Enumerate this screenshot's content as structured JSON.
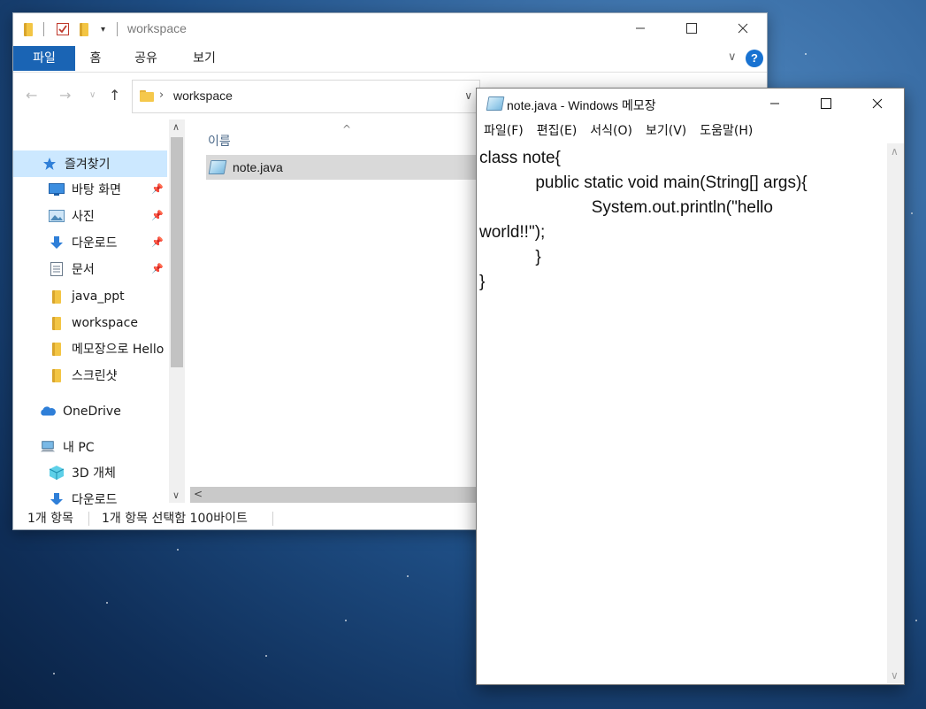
{
  "explorer": {
    "title": "workspace",
    "ribbon_tabs": [
      "파일",
      "홈",
      "공유",
      "보기"
    ],
    "help_label": "?",
    "address": {
      "path_segment": "workspace"
    },
    "column_header": "이름",
    "files": [
      {
        "name": "note.java",
        "icon": "java-file-icon",
        "selected": true
      }
    ],
    "nav_items": [
      {
        "label": "즐겨찾기",
        "icon": "star-icon",
        "active": true,
        "pinned": false
      },
      {
        "label": "바탕 화면",
        "icon": "desktop-icon",
        "active": false,
        "pinned": true
      },
      {
        "label": "사진",
        "icon": "pictures-icon",
        "active": false,
        "pinned": true
      },
      {
        "label": "다운로드",
        "icon": "download-icon",
        "active": false,
        "pinned": true
      },
      {
        "label": "문서",
        "icon": "documents-icon",
        "active": false,
        "pinned": true
      },
      {
        "label": "java_ppt",
        "icon": "folder-icon",
        "active": false,
        "pinned": false
      },
      {
        "label": "workspace",
        "icon": "folder-icon",
        "active": false,
        "pinned": false
      },
      {
        "label": "메모장으로 Hello",
        "icon": "folder-icon",
        "active": false,
        "pinned": false
      },
      {
        "label": "스크린샷",
        "icon": "folder-icon",
        "active": false,
        "pinned": false
      },
      {
        "label": "OneDrive",
        "icon": "cloud-icon",
        "active": false,
        "pinned": false
      },
      {
        "label": "내 PC",
        "icon": "pc-icon",
        "active": false,
        "pinned": false
      },
      {
        "label": "3D 개체",
        "icon": "3d-objects-icon",
        "active": false,
        "pinned": false
      },
      {
        "label": "다운로드",
        "icon": "download-icon",
        "active": false,
        "pinned": false
      }
    ],
    "status": {
      "count": "1개 항목",
      "selection": "1개 항목 선택함 100바이트"
    }
  },
  "notepad": {
    "title": "note.java - Windows 메모장",
    "menu": [
      "파일(F)",
      "편집(E)",
      "서식(O)",
      "보기(V)",
      "도움말(H)"
    ],
    "content_lines": [
      "class note{",
      "\t\tpublic static void main(String[] args){",
      "\t\t\t\tSystem.out.println(\"hello",
      "world!!\");",
      "\t\t}",
      "}"
    ]
  },
  "colors": {
    "accent": "#1a64b4",
    "selection": "#cce8ff",
    "file_selected": "#d9d9d9"
  }
}
